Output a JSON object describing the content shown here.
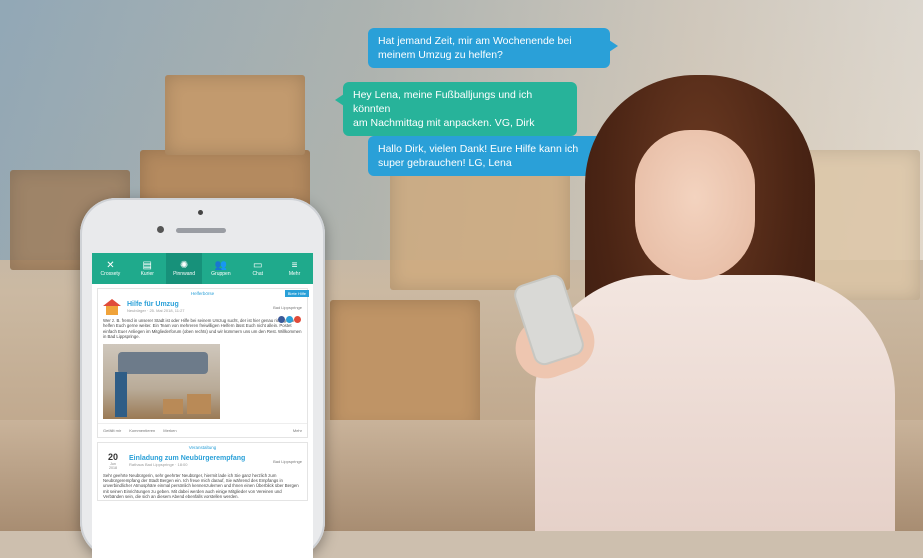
{
  "bubbles": [
    {
      "text_line1": "Hat jemand Zeit, mir am Wochenende bei",
      "text_line2": "meinem Umzug zu helfen?"
    },
    {
      "text_line1": "Hey Lena, meine Fußballjungs und ich könnten",
      "text_line2": "am Nachmittag mit anpacken. VG, Dirk"
    },
    {
      "text_line1": "Hallo Dirk, vielen Dank! Eure Hilfe kann ich",
      "text_line2": "super gebrauchen! LG, Lena"
    }
  ],
  "app": {
    "tabs": [
      {
        "label": "Crossety",
        "icon": "crossety-icon",
        "glyph": "✕"
      },
      {
        "label": "Kurier",
        "icon": "news-icon",
        "glyph": "▤"
      },
      {
        "label": "Pinnwand",
        "icon": "pinboard-icon",
        "glyph": "✺"
      },
      {
        "label": "Gruppen",
        "icon": "groups-icon",
        "glyph": "👥"
      },
      {
        "label": "Chat",
        "icon": "chat-icon",
        "glyph": "▭"
      },
      {
        "label": "Mehr",
        "icon": "menu-icon",
        "glyph": "≡"
      }
    ],
    "active_tab": "Pinnwand",
    "post1": {
      "category": "Helferbörse",
      "flag": "Biete Hilfe",
      "title": "Hilfe für Umzug",
      "meta": "Neubürger · 25. Mai 2018, 11:27",
      "location": "Bad Lippspringe",
      "body": "Wer z. B. fremd in unserer Stadt ist oder Hilfe bei seinem Umzug sucht, der ist hier genau richtig: Wir helfen Euch gerne weiter. Ein Team von mehreren freiwilligen Helfern lässt Euch nicht allein. Postet einfach Euer Anliegen im Mitgliederforum (oben rechts) und wir kümmern uns um den Rest. Willkommen in Bad Lippspringe.",
      "actions": [
        "Gefällt mir",
        "Kommentieren",
        "Merken"
      ],
      "more": "Mehr"
    },
    "post2": {
      "category": "Veranstaltung",
      "date_day": "20",
      "date_month": "Jun",
      "date_year": "2018",
      "title": "Einladung zum Neubürgerempfang",
      "meta": "Rathaus Bad Lippspringe · 18:00",
      "location": "Bad Lippspringe",
      "body": "Sehr geehrte Neubürgerin, sehr geehrter Neubürger, hiermit lade ich Sie ganz herzlich zum Neubürgerempfang der Stadt Bergen ein. Ich freue mich darauf, Sie während des Empfangs in unverbindlicher Atmosphäre einmal persönlich kennenzulernen und Ihnen einen Überblick über Bergen mit seinen Einrichtungen zu geben. Mit dabei werden auch einige Mitglieder von Vereinen und Verbänden sein, die sich an diesem Abend ebenfalls vorstellen werden."
    }
  },
  "colors": {
    "teal": "#1faa8c",
    "blue": "#2aa0d8",
    "bubble_teal": "#27b39a"
  }
}
